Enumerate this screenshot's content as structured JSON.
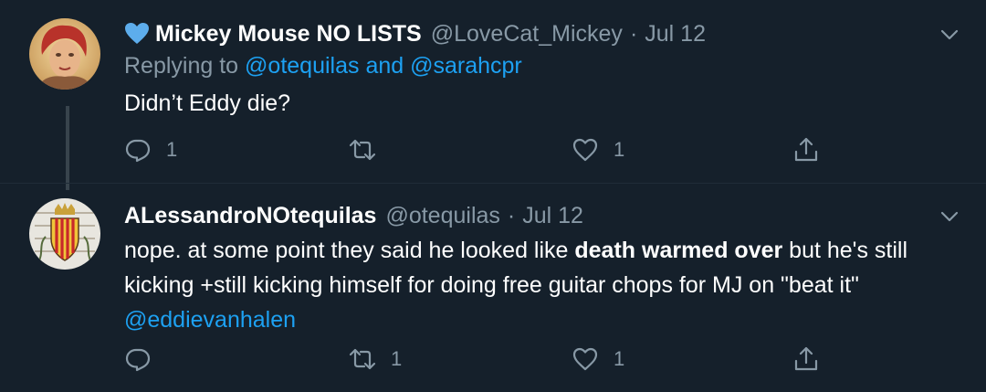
{
  "tweet1": {
    "display_name": "Mickey Mouse NO LISTS",
    "name_emoji": "blue-heart-icon",
    "handle": "@LoveCat_Mickey",
    "separator": "·",
    "date": "Jul 12",
    "replying_prefix": "Replying to",
    "replying_user1": "@otequilas",
    "replying_and": "and",
    "replying_user2": "@sarahcpr",
    "text": "Didn’t Eddy die?",
    "reply_count": "1",
    "retweet_count": "",
    "like_count": "1"
  },
  "tweet2": {
    "display_name": "ALessandroNOtequilas",
    "handle": "@otequilas",
    "separator": "·",
    "date": "Jul 12",
    "text_part1": "nope.  at some point they said he looked like ",
    "text_bold": "death warmed over",
    "text_part2": " but he's still kicking +still kicking himself for doing free guitar chops for MJ on \"beat it\" ",
    "text_mention": "@eddievanhalen",
    "reply_count": "",
    "retweet_count": "1",
    "like_count": "1"
  },
  "colors": {
    "background": "#15202b",
    "secondary_text": "#8899a6",
    "link": "#1da1f2",
    "heart_emoji": "#5dadec"
  }
}
